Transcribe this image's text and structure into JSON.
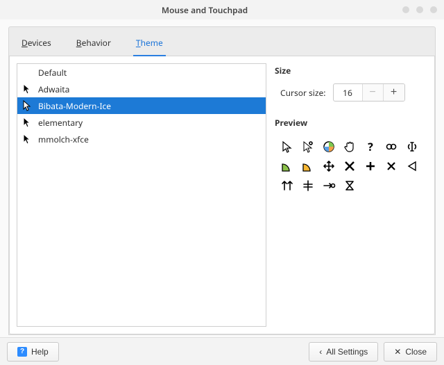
{
  "window": {
    "title": "Mouse and Touchpad"
  },
  "tabs": {
    "devices": {
      "label": "Devices",
      "accel_index": 0
    },
    "behavior": {
      "label": "Behavior",
      "accel_index": 0
    },
    "theme": {
      "label": "Theme",
      "accel_index": 0
    }
  },
  "active_tab": "theme",
  "themes": {
    "items": [
      {
        "name": "Default",
        "has_icon": false,
        "selected": false
      },
      {
        "name": "Adwaita",
        "has_icon": true,
        "icon_style": "black",
        "selected": false
      },
      {
        "name": "Bibata-Modern-Ice",
        "has_icon": true,
        "icon_style": "white",
        "selected": true
      },
      {
        "name": "elementary",
        "has_icon": true,
        "icon_style": "black",
        "selected": false
      },
      {
        "name": "mmolch-xfce",
        "has_icon": true,
        "icon_style": "black",
        "selected": false
      }
    ]
  },
  "size": {
    "section_title": "Size",
    "label": "Cursor size:",
    "value": "16"
  },
  "preview": {
    "section_title": "Preview",
    "cursors": [
      "pointer",
      "select",
      "wait-circle",
      "hand",
      "help",
      "link",
      "text-i",
      "corner-green",
      "corner-yellow",
      "move",
      "not-allowed",
      "plus",
      "cross",
      "play-left",
      "split-h",
      "split-v",
      "arrow-right",
      "hourglass"
    ]
  },
  "footer": {
    "help": "Help",
    "all_settings": "All Settings",
    "close": "Close"
  }
}
